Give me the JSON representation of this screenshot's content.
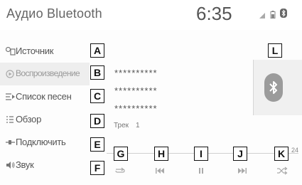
{
  "header": {
    "title": "Аудио Bluetooth",
    "clock": "6:35"
  },
  "status_icons": [
    "signal-icon",
    "battery-icon",
    "bluetooth-status-icon"
  ],
  "sidebar": {
    "items": [
      {
        "label": "Источник",
        "icon": "source-icon",
        "active": false
      },
      {
        "label": "Воспроизведение",
        "icon": "play-circle-icon",
        "active": true
      },
      {
        "label": "Список песен",
        "icon": "song-list-icon",
        "active": false
      },
      {
        "label": "Обзор",
        "icon": "browse-icon",
        "active": false
      },
      {
        "label": "Подключить",
        "icon": "connect-icon",
        "active": false
      },
      {
        "label": "Звук",
        "icon": "speaker-icon",
        "active": false
      }
    ]
  },
  "track": {
    "lines": [
      "**********",
      "**********",
      "**********"
    ],
    "label": "Трек",
    "number": "1"
  },
  "album_art": {
    "icon": "bluetooth-icon",
    "badge_color": "#9b9b9b"
  },
  "progress": {
    "end_text": "24"
  },
  "controls": [
    {
      "name": "repeat-button",
      "icon": "repeat-icon"
    },
    {
      "name": "previous-button",
      "icon": "skip-previous-icon"
    },
    {
      "name": "pause-button",
      "icon": "pause-icon"
    },
    {
      "name": "next-button",
      "icon": "skip-next-icon"
    },
    {
      "name": "shuffle-button",
      "icon": "shuffle-icon"
    }
  ],
  "callouts": [
    "A",
    "B",
    "C",
    "D",
    "E",
    "F",
    "G",
    "H",
    "I",
    "J",
    "K",
    "L"
  ]
}
